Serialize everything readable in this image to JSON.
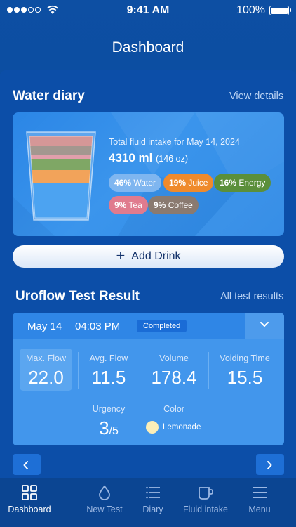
{
  "status_bar": {
    "time": "9:41 AM",
    "battery": "100%"
  },
  "header": {
    "title": "Dashboard"
  },
  "water_diary": {
    "title": "Water diary",
    "link": "View details",
    "intake_label": "Total fluid intake for May 14, 2024",
    "intake_ml": "4310 ml",
    "intake_oz": "(146 oz)",
    "breakdown": [
      {
        "pct": "46%",
        "name": "Water",
        "color": "#7fb6f0"
      },
      {
        "pct": "19%",
        "name": "Juice",
        "color": "#ef8a2c"
      },
      {
        "pct": "16%",
        "name": "Energy",
        "color": "#5b8f3a"
      },
      {
        "pct": "9%",
        "name": "Tea",
        "color": "#e07b8e"
      },
      {
        "pct": "9%",
        "name": "Coffee",
        "color": "#8a7a70"
      }
    ],
    "add_button": "Add Drink"
  },
  "uroflow": {
    "title": "Uroflow Test Result",
    "link": "All test results",
    "date": "May 14",
    "time": "04:03 PM",
    "status": "Completed",
    "metrics": [
      {
        "label": "Max. Flow",
        "value": "22.0"
      },
      {
        "label": "Avg. Flow",
        "value": "11.5"
      },
      {
        "label": "Volume",
        "value": "178.4"
      },
      {
        "label": "Voiding Time",
        "value": "15.5"
      }
    ],
    "urgency": {
      "label": "Urgency",
      "value": "3",
      "scale": "/5"
    },
    "color": {
      "label": "Color",
      "value": "Lemonade",
      "swatch": "#fbeeb8"
    }
  },
  "tabs": [
    {
      "label": "Dashboard",
      "icon": "grid-icon",
      "active": true
    },
    {
      "label": "New Test",
      "icon": "drop-icon",
      "active": false
    },
    {
      "label": "Diary",
      "icon": "list-icon",
      "active": false
    },
    {
      "label": "Fluid intake",
      "icon": "cup-icon",
      "active": false
    },
    {
      "label": "Menu",
      "icon": "menu-icon",
      "active": false
    }
  ]
}
